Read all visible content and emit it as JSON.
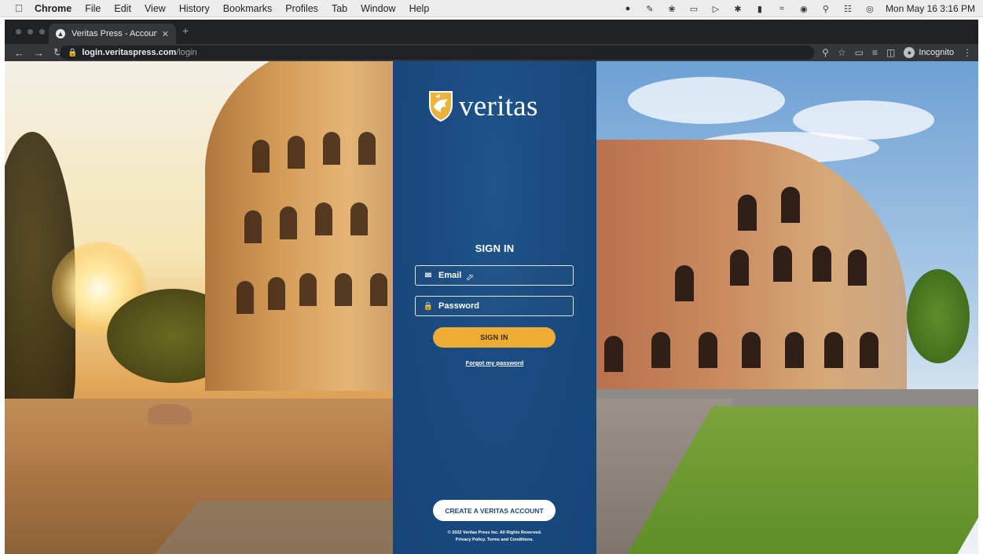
{
  "menubar": {
    "items": [
      "Chrome",
      "File",
      "Edit",
      "View",
      "History",
      "Bookmarks",
      "Profiles",
      "Tab",
      "Window",
      "Help"
    ],
    "datetime": "Mon May 16  3:16 PM"
  },
  "browser": {
    "tab_title": "Veritas Press - Accounts",
    "url_host": "login.veritaspress.com",
    "url_path": "/login",
    "incognito_label": "Incognito"
  },
  "panel": {
    "brand": "veritas",
    "signin_title": "SIGN IN",
    "email_placeholder": "Email",
    "password_placeholder": "Password",
    "signin_button": "SIGN IN",
    "forgot_link": "Forgot my password",
    "create_button": "CREATE A VERITAS ACCOUNT",
    "copyright": "© 2022 Veritas Press Inc. All Rights Reserved.",
    "privacy_link": "Privacy Policy.",
    "terms_link": "Terms and Conditions."
  },
  "colors": {
    "panel_blue": "#1a4b80",
    "signin_gold": "#efac35",
    "create_white": "#ffffff"
  },
  "icons": [
    "apple-icon",
    "tab-favicon",
    "lock-icon",
    "key-icon",
    "star-icon",
    "envelope-icon",
    "padlock-icon",
    "incognito-icon"
  ]
}
